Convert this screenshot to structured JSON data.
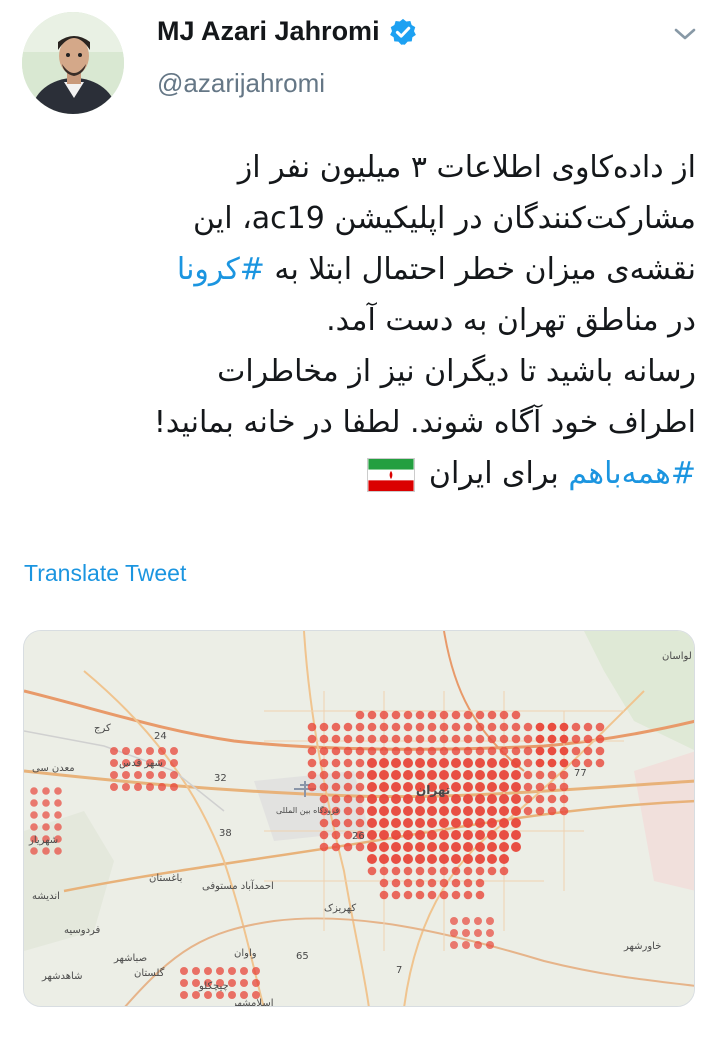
{
  "author": {
    "display_name": "MJ Azari Jahromi",
    "handle": "@azarijahromi"
  },
  "tweet": {
    "lines": [
      "از داده‌کاوی اطلاعات ۳ میلیون نفر از",
      "مشارکت‌کنندگان در اپلیکیشن ac19، این",
      "نقشه‌ی میزان خطر احتمال ابتلا به",
      "در مناطق تهران به دست آمد.",
      "رسانه باشید تا دیگران نیز از مخاطرات",
      "اطراف خود آگاه شوند. لطفا در خانه بمانید!",
      "برای ایران"
    ],
    "hashtag_corona": "#کرونا",
    "hashtag_hamebahamm": "#همه‌باهم"
  },
  "translate_label": "Translate Tweet",
  "map": {
    "labels": {
      "tehran": "تهران",
      "karaj": "کرج",
      "shahriar": "شهریار",
      "shahr_e_ghods": "شهر قدس",
      "eslamshahr": "اسلامشهر",
      "lavasan": "لواسان",
      "andisheh": "اندیشه",
      "baghestan": "باغستان",
      "ahmadabad": "احمدآباد مستوفی",
      "vavan": "واوان",
      "golestan": "گلستان",
      "sabashahr": "صباشهر",
      "ferdowsiyeh": "فردوسیه",
      "shahedshahr": "شاهدشهر",
      "khavarshahr": "خاورشهر",
      "madan": "معدن سی",
      "kahrizak": "کهریزک",
      "chichaklou": "چیچکلو",
      "airport": "فرودگاه بین المللی",
      "road_24": "24",
      "road_32": "32",
      "road_38": "38",
      "road_26": "26",
      "road_65": "65",
      "road_7": "7",
      "road_77": "77"
    }
  },
  "colors": {
    "link": "#1b95e0",
    "verified": "#1da1f2",
    "text": "#14171a",
    "secondary": "#657786",
    "risk_dot": "#e8463a"
  }
}
